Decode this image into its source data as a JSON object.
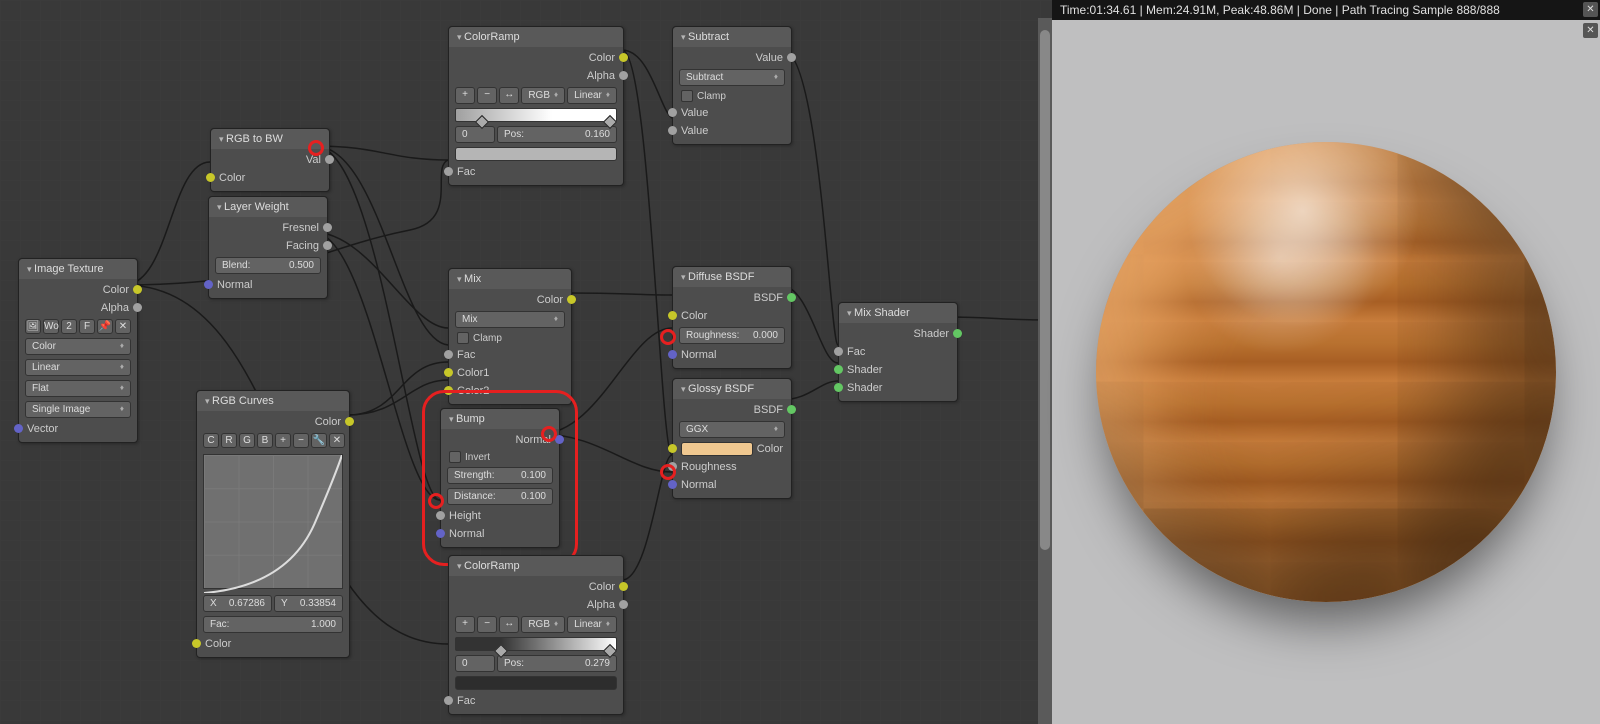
{
  "status_bar": "Time:01:34.61 | Mem:24.91M, Peak:48.86M | Done | Path Tracing Sample 888/888",
  "nodes": {
    "image_texture": {
      "title": "Image Texture",
      "out_color": "Color",
      "out_alpha": "Alpha",
      "browse": "Wo",
      "page": "2",
      "fake": "F",
      "pin": "📌",
      "close": "✕",
      "colorspace": "Color",
      "interp": "Linear",
      "proj": "Flat",
      "source": "Single Image",
      "in_vector": "Vector"
    },
    "rgb_to_bw": {
      "title": "RGB to BW",
      "out_val": "Val",
      "in_color": "Color"
    },
    "layer_weight": {
      "title": "Layer Weight",
      "out_fresnel": "Fresnel",
      "out_facing": "Facing",
      "blend_label": "Blend:",
      "blend_val": "0.500",
      "in_normal": "Normal"
    },
    "rgb_curves": {
      "title": "RGB Curves",
      "out_color": "Color",
      "tabs": [
        "C",
        "R",
        "G",
        "B"
      ],
      "x_label": "X",
      "x_val": "0.67286",
      "y_label": "Y",
      "y_val": "0.33854",
      "fac_label": "Fac:",
      "fac_val": "1.000",
      "in_color": "Color"
    },
    "color_ramp1": {
      "title": "ColorRamp",
      "out_color": "Color",
      "out_alpha": "Alpha",
      "mode": "RGB",
      "interp": "Linear",
      "idx": "0",
      "pos_label": "Pos:",
      "pos_val": "0.160",
      "in_fac": "Fac"
    },
    "color_ramp2": {
      "title": "ColorRamp",
      "out_color": "Color",
      "out_alpha": "Alpha",
      "mode": "RGB",
      "interp": "Linear",
      "idx": "0",
      "pos_label": "Pos:",
      "pos_val": "0.279",
      "in_fac": "Fac"
    },
    "subtract": {
      "title": "Subtract",
      "out_value": "Value",
      "op": "Subtract",
      "clamp": "Clamp",
      "in_value1": "Value",
      "in_value2": "Value"
    },
    "mix": {
      "title": "Mix",
      "out_color": "Color",
      "blend": "Mix",
      "clamp": "Clamp",
      "in_fac": "Fac",
      "in_color1": "Color1",
      "in_color2": "Color2"
    },
    "bump": {
      "title": "Bump",
      "out_normal": "Normal",
      "invert": "Invert",
      "strength_label": "Strength:",
      "strength_val": "0.100",
      "distance_label": "Distance:",
      "distance_val": "0.100",
      "in_height": "Height",
      "in_normal": "Normal"
    },
    "diffuse": {
      "title": "Diffuse BSDF",
      "out_bsdf": "BSDF",
      "in_color": "Color",
      "roughness_label": "Roughness:",
      "roughness_val": "0.000",
      "in_normal": "Normal"
    },
    "glossy": {
      "title": "Glossy BSDF",
      "out_bsdf": "BSDF",
      "dist": "GGX",
      "in_color": "Color",
      "in_roughness": "Roughness",
      "in_normal": "Normal"
    },
    "mix_shader": {
      "title": "Mix Shader",
      "out_shader": "Shader",
      "in_fac": "Fac",
      "in_shader1": "Shader",
      "in_shader2": "Shader"
    }
  }
}
